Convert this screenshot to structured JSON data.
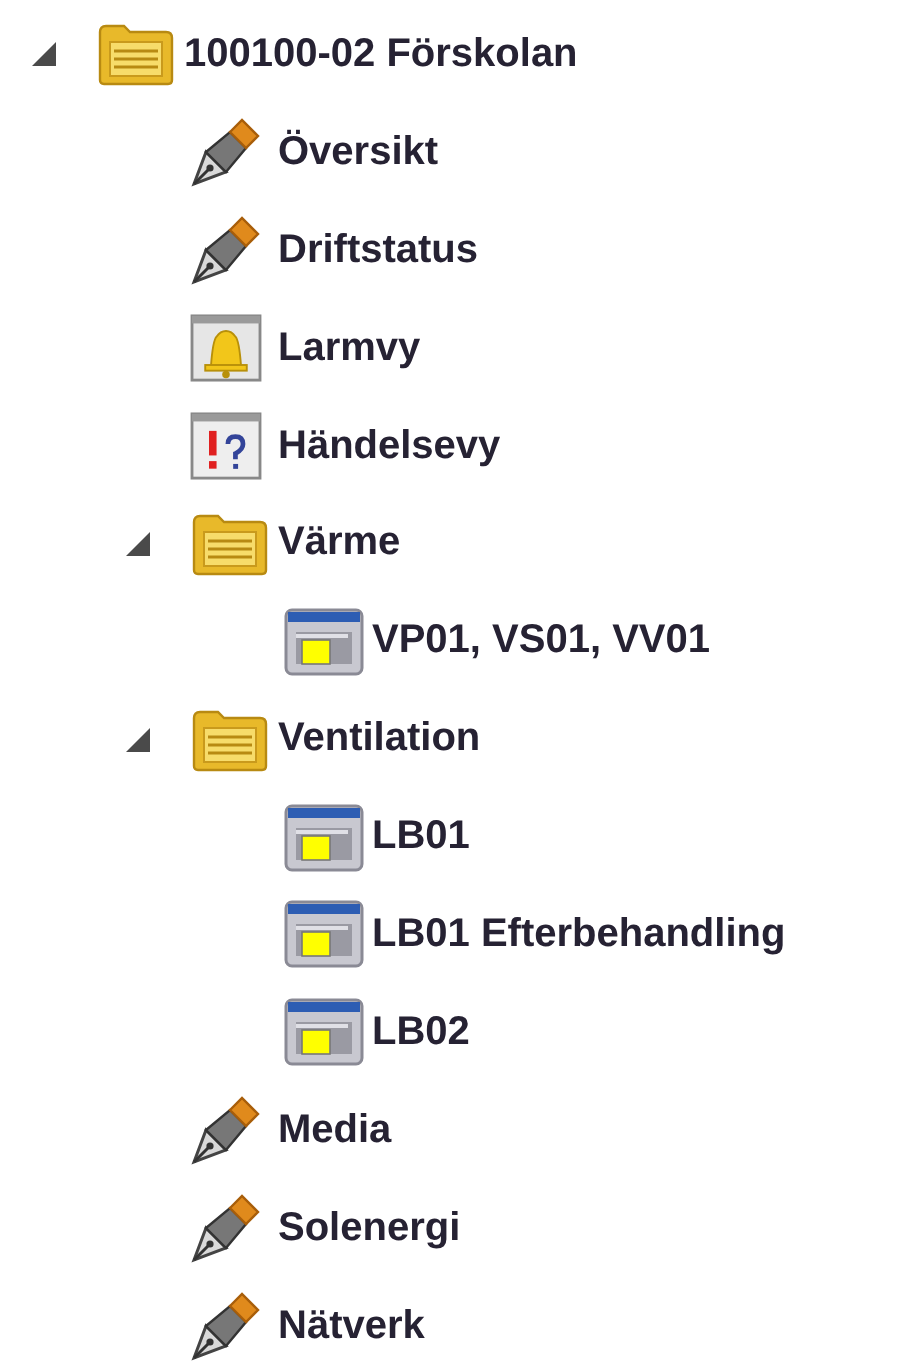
{
  "tree": [
    {
      "label": "100100-02 Förskolan",
      "kind": "folder",
      "expanded": true,
      "children": [
        {
          "label": "Översikt",
          "kind": "pen"
        },
        {
          "label": "Driftstatus",
          "kind": "pen"
        },
        {
          "label": "Larmvy",
          "kind": "alarm"
        },
        {
          "label": "Händelsevy",
          "kind": "event"
        },
        {
          "label": "Värme",
          "kind": "folder",
          "expanded": true,
          "children": [
            {
              "label": "VP01, VS01, VV01",
              "kind": "window"
            }
          ]
        },
        {
          "label": "Ventilation",
          "kind": "folder",
          "expanded": true,
          "children": [
            {
              "label": "LB01",
              "kind": "window"
            },
            {
              "label": "LB01 Efterbehandling",
              "kind": "window"
            },
            {
              "label": "LB02",
              "kind": "window"
            }
          ]
        },
        {
          "label": "Media",
          "kind": "pen"
        },
        {
          "label": "Solenergi",
          "kind": "pen"
        },
        {
          "label": "Nätverk",
          "kind": "pen"
        }
      ]
    }
  ]
}
